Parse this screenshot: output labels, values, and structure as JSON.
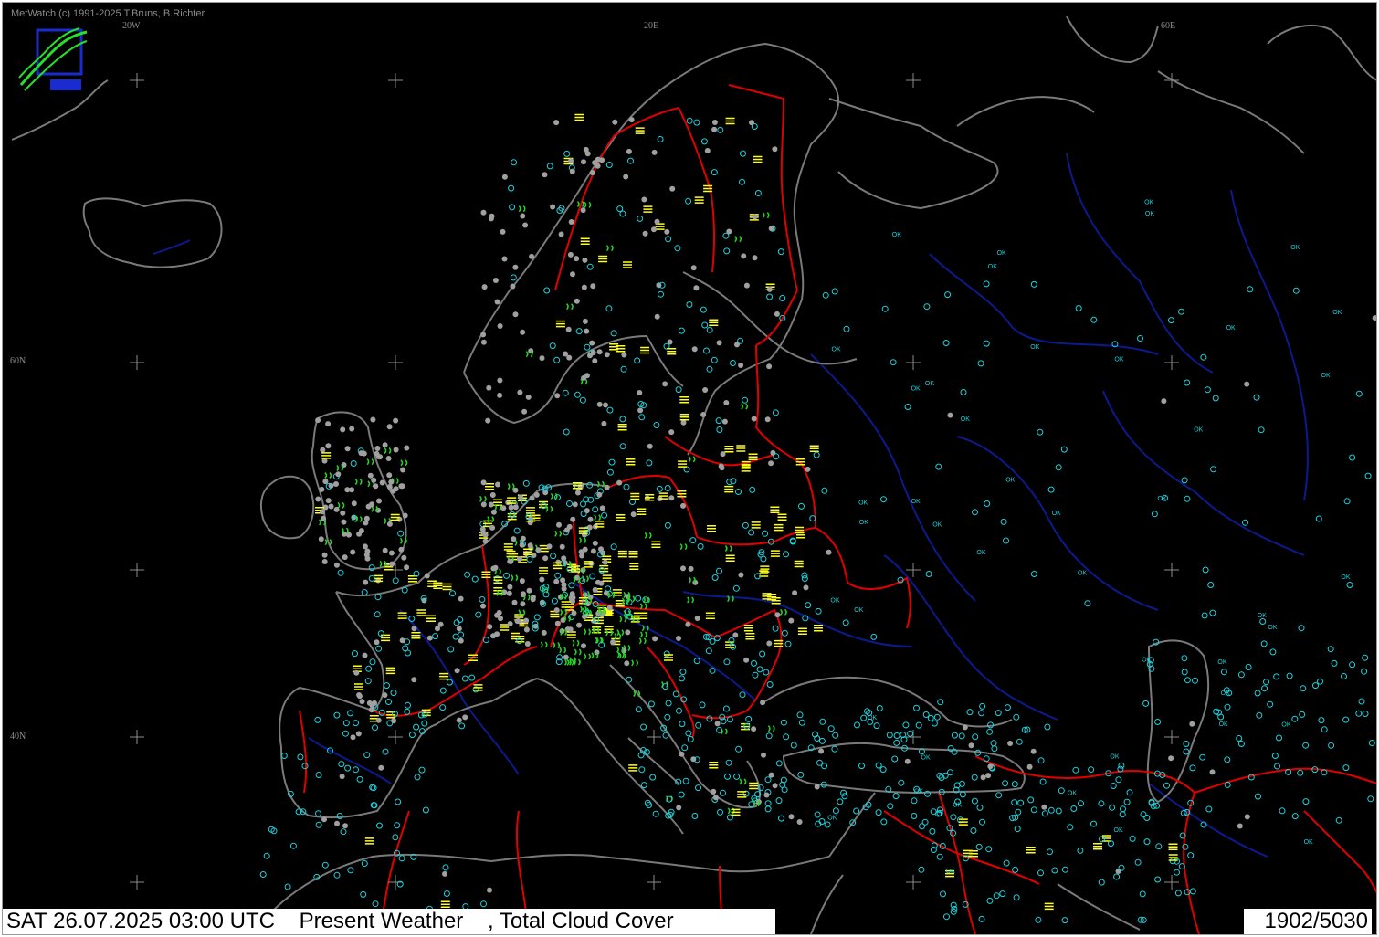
{
  "app": {
    "credit": "MetWatch  (c) 1991-2025 T.Bruns, B.Richter"
  },
  "map": {
    "title": "Present Weather , Total Cloud Cover",
    "date_time": "SAT 26.07.2025 03:00 UTC",
    "product": "Present Weather",
    "secondary_product": ", Total Cloud Cover",
    "station_count": "1902/5030",
    "grid_labels": {
      "lon_20w": "20W",
      "lon_20e": "20E",
      "lon_60e": "60E",
      "lat_60n": "60N",
      "lat_40n": "40N"
    },
    "colors": {
      "background": "#000000",
      "coastline": "#7a7a7a",
      "borders": "#e00000",
      "rivers": "#0c1a8c",
      "cloud_cover_symbol": "#1ed2dc",
      "rain_symbol": "#22d622",
      "fog_symbol": "#ffff1e",
      "no_data_station": "#a0a0a0",
      "thunderstorm_symbol": "#ff2020"
    },
    "legend_words": {
      "ok_label": "OK"
    },
    "icons": [
      "metwatch-logo-icon",
      "grid-cross-icon",
      "station-dot-icon",
      "fog-symbol-icon",
      "drizzle-symbol-icon",
      "cloud-cover-circle-icon"
    ]
  }
}
